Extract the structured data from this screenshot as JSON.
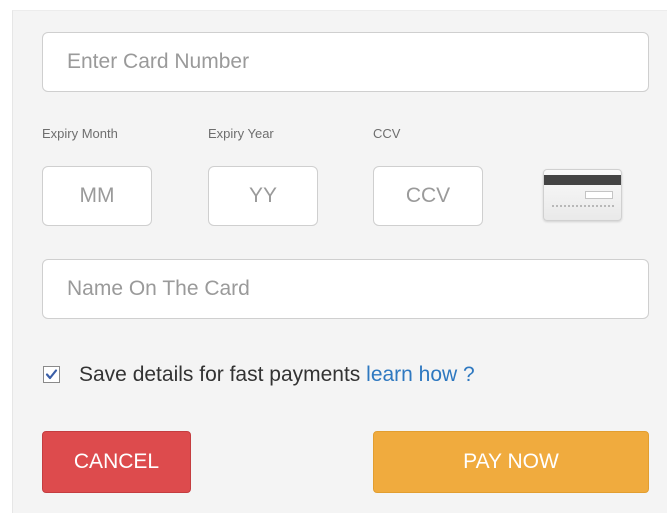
{
  "card_number": {
    "placeholder": "Enter Card Number",
    "value": ""
  },
  "expiry_month": {
    "label": "Expiry Month",
    "placeholder": "MM",
    "value": ""
  },
  "expiry_year": {
    "label": "Expiry Year",
    "placeholder": "YY",
    "value": ""
  },
  "ccv": {
    "label": "CCV",
    "placeholder": "CCV",
    "value": ""
  },
  "card_icon": "credit-card-back-icon",
  "name_on_card": {
    "placeholder": "Name On The Card",
    "value": ""
  },
  "save_details": {
    "checked": true,
    "label": "Save details for fast payments",
    "link_text": "learn how ?"
  },
  "buttons": {
    "cancel_label": "CANCEL",
    "pay_label": "PAY NOW"
  },
  "colors": {
    "cancel": "#dd4b4d",
    "pay": "#f0ab3e",
    "link": "#2e78c0",
    "panel_background": "#f4f4f4"
  }
}
